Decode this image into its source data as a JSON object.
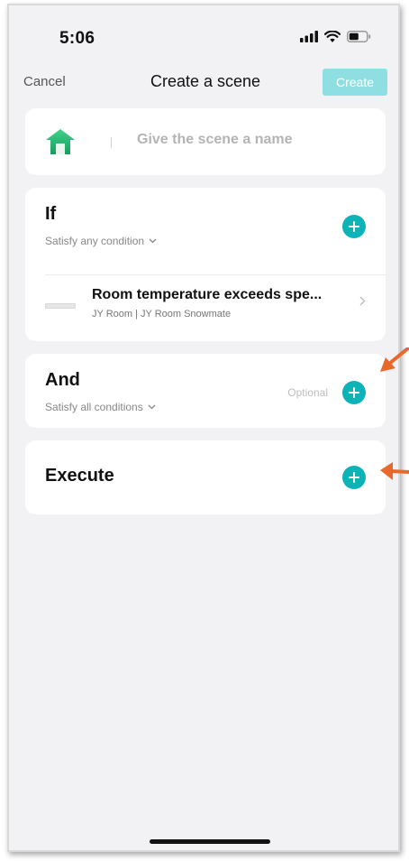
{
  "status_bar": {
    "time": "5:06"
  },
  "nav": {
    "cancel_label": "Cancel",
    "title": "Create a scene",
    "create_label": "Create"
  },
  "scene_name": {
    "placeholder": "Give the scene a name",
    "value": ""
  },
  "if_section": {
    "title": "If",
    "subtitle": "Satisfy any condition",
    "conditions": [
      {
        "title": "Room temperature exceeds spe...",
        "subtitle": "JY Room | JY Room Snowmate"
      }
    ]
  },
  "and_section": {
    "title": "And",
    "subtitle": "Satisfy all conditions",
    "optional_label": "Optional"
  },
  "execute_section": {
    "title": "Execute"
  },
  "icons": {
    "home": "home-icon",
    "add": "plus-circle-icon",
    "chevron_down": "chevron-down-icon",
    "chevron_right": "chevron-right-icon",
    "signal": "cellular-signal-icon",
    "wifi": "wifi-icon",
    "battery": "battery-icon",
    "device": "air-conditioner-icon",
    "annotation": "arrow-annotation-icon"
  },
  "colors": {
    "accent": "#0eb3b8",
    "create_disabled": "#8fdfe2",
    "home_green": "#22b573",
    "annotation_arrow": "#e8692b",
    "background": "#f2f2f4"
  }
}
